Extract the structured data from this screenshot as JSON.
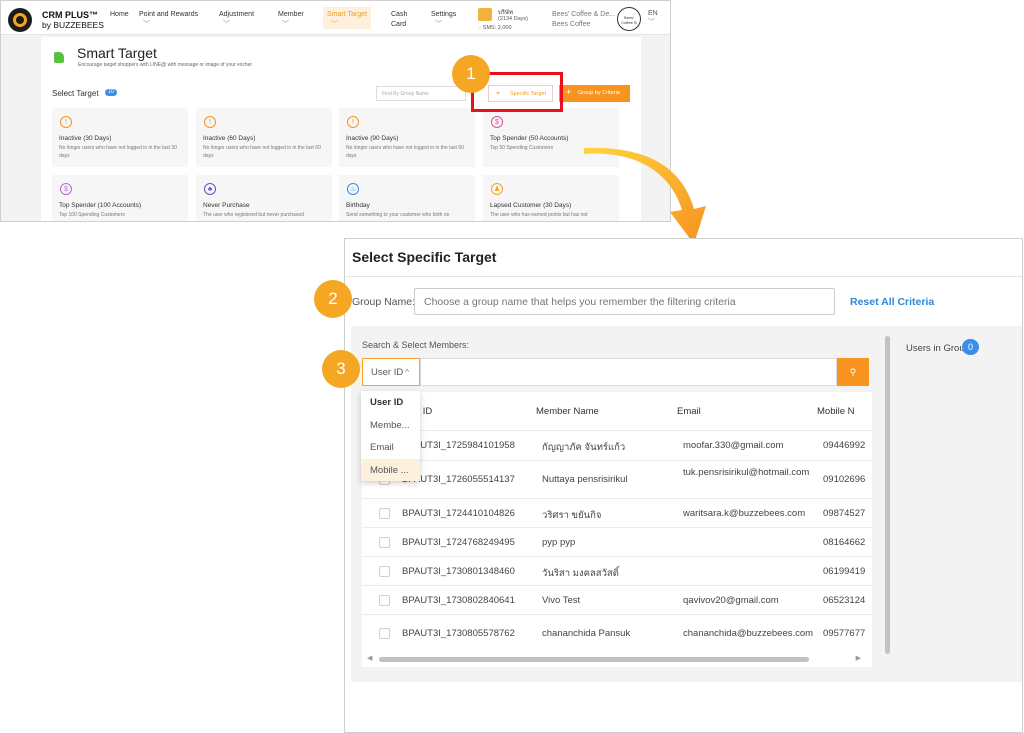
{
  "app": {
    "brand_line1": "CRM PLUS™",
    "brand_line2": "by BUZZEBEES",
    "nav": [
      "Home",
      "Point and Rewards",
      "Adjustment",
      "Member",
      "Smart Target",
      "Cash Card",
      "Settings"
    ],
    "nav_active": "Smart Target",
    "credit_label": "บริษัท",
    "credit_days": "(2134 Days)",
    "credit_sms": "SMS: 2,000",
    "shop_name": "Bees' Coffee & De...",
    "shop_name2": "Bees Coffee",
    "shop_avatar": "Bees' Coffee B",
    "lang": "EN"
  },
  "smart_target": {
    "title": "Smart Target",
    "subtitle": "Encourage target shoppers with LINE@ with message or image of your vocher",
    "select_label": "Select Target",
    "select_count": "10",
    "find_placeholder": "Find By Group Name",
    "specific_button": "Specific Target",
    "criteria_button": "Group by Criteria",
    "cards": [
      {
        "title": "Inactive (30 Days)",
        "desc": "No longer users who have not logged in in the last 30 days",
        "icon": "alert-icon",
        "color": "#f7931e"
      },
      {
        "title": "Inactive (60 Days)",
        "desc": "No longer users who have not logged in in the last 60 days",
        "icon": "alert-icon",
        "color": "#f7931e"
      },
      {
        "title": "Inactive (90 Days)",
        "desc": "No longer users who have not logged in in the last 90 days",
        "icon": "alert-icon",
        "color": "#f7931e"
      },
      {
        "title": "Top Spender (50 Accounts)",
        "desc": "Top 50 Spending Customers",
        "icon": "coin-icon",
        "color": "#e84a9b"
      },
      {
        "title": "Top Spender (100 Accounts)",
        "desc": "Top 100 Spending Customers",
        "icon": "coin-icon",
        "color": "#b56fd6"
      },
      {
        "title": "Never Purchase",
        "desc": "The user who registered but never purchased",
        "icon": "bell-icon",
        "color": "#6a4fc7"
      },
      {
        "title": "Birthday",
        "desc": "Send something to your customer who birth on",
        "icon": "cake-icon",
        "color": "#3d8ee9"
      },
      {
        "title": "Lapsed Customer (30 Days)",
        "desc": "The user who has earned points but has not",
        "icon": "users-icon",
        "color": "#f5a623"
      }
    ]
  },
  "steps": [
    "1",
    "2",
    "3"
  ],
  "dialog": {
    "title": "Select Specific Target",
    "group_name_label": "Group Name:",
    "group_name_placeholder": "Choose a group name that helps you remember the filtering criteria",
    "reset_label": "Reset All Criteria",
    "search_label": "Search & Select Members:",
    "search_type": "User ID",
    "search_icon": "search-icon",
    "users_in_group_label": "Users in Group:",
    "users_in_group_count": "0",
    "dropdown_options": [
      "User ID",
      "Membe...",
      "Email",
      "Mobile ..."
    ],
    "columns": [
      "User ID",
      "Member Name",
      "Email",
      "Mobile N"
    ],
    "rows": [
      {
        "user_id": "BPAUT3I_1725984101958",
        "name": "กัญญาภัค จันทร์แก้ว",
        "email": "moofar.330@gmail.com",
        "mobile": "09446992"
      },
      {
        "user_id": "BPAUT3I_1726055514137",
        "name": "Nuttaya pensrisirikul",
        "email": "tuk.pensrisirikul@hotmail.com",
        "mobile": "09102696"
      },
      {
        "user_id": "BPAUT3I_1724410104826",
        "name": "วริศรา ขยันกิจ",
        "email": "waritsara.k@buzzebees.com",
        "mobile": "09874527"
      },
      {
        "user_id": "BPAUT3I_1724768249495",
        "name": "pyp pyp",
        "email": "",
        "mobile": "08164662"
      },
      {
        "user_id": "BPAUT3I_1730801348460",
        "name": "วันริสา มงคลสวัสดิ์",
        "email": "",
        "mobile": "06199419"
      },
      {
        "user_id": "BPAUT3I_1730802840641",
        "name": "Vivo Test",
        "email": "qavivov20@gmail.com",
        "mobile": "06523124"
      },
      {
        "user_id": "BPAUT3I_1730805578762",
        "name": "chananchida Pansuk",
        "email": "chananchida@buzzebees.com",
        "mobile": "09577677"
      }
    ]
  }
}
